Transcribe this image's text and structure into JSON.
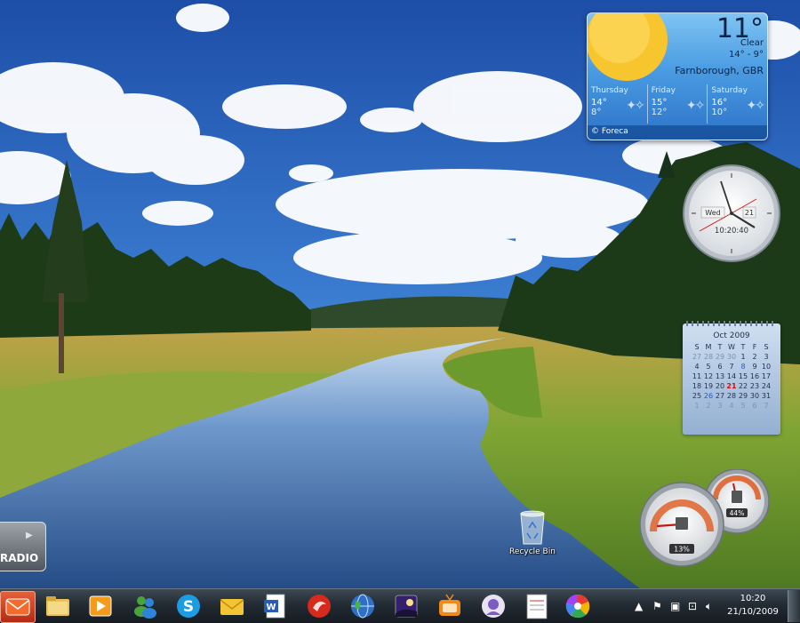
{
  "desktop": {
    "recycle_bin": {
      "label": "Recycle Bin",
      "icon": "recycle-bin-icon"
    }
  },
  "weather_gadget": {
    "temperature": "11°",
    "condition": "Clear",
    "range": "14° - 9°",
    "location": "Farnborough, GBR",
    "forecast": [
      {
        "day": "Thursday",
        "high": "14°",
        "low": "8°"
      },
      {
        "day": "Friday",
        "high": "15°",
        "low": "12°"
      },
      {
        "day": "Saturday",
        "high": "16°",
        "low": "10°"
      }
    ],
    "provider": "© Foreca",
    "accent": "#4a9be2"
  },
  "clock_gadget": {
    "day": "Wed",
    "date": "21",
    "time": "10:20:40"
  },
  "calendar_gadget": {
    "month": "Oct 2009",
    "weekdays": [
      "S",
      "M",
      "T",
      "W",
      "T",
      "F",
      "S"
    ],
    "weeks": [
      [
        "27",
        "28",
        "29",
        "30",
        "1",
        "2",
        "3"
      ],
      [
        "4",
        "5",
        "6",
        "7",
        "8",
        "9",
        "10"
      ],
      [
        "11",
        "12",
        "13",
        "14",
        "15",
        "16",
        "17"
      ],
      [
        "18",
        "19",
        "20",
        "21",
        "22",
        "23",
        "24"
      ],
      [
        "25",
        "26",
        "27",
        "28",
        "29",
        "30",
        "31"
      ],
      [
        "1",
        "2",
        "3",
        "4",
        "5",
        "6",
        "7"
      ]
    ],
    "today": "21"
  },
  "cpu_meter_gadget": {
    "cpu_percent": "13%",
    "memory_percent": "44%",
    "cpu_level": 13,
    "memory_level": 44
  },
  "radio_gadget": {
    "label": "RADIO"
  },
  "taskbar": {
    "start_icon": "mail-envelope-icon",
    "pinned": [
      "folder-icon",
      "media-player-icon",
      "messenger-icon",
      "skype-icon",
      "mail-icon",
      "word-icon",
      "app-red-icon",
      "globe-icon",
      "night-sky-icon",
      "tv-icon",
      "chat-icon",
      "document-icon",
      "picasa-icon"
    ],
    "time": "10:20",
    "date": "21/10/2009"
  }
}
